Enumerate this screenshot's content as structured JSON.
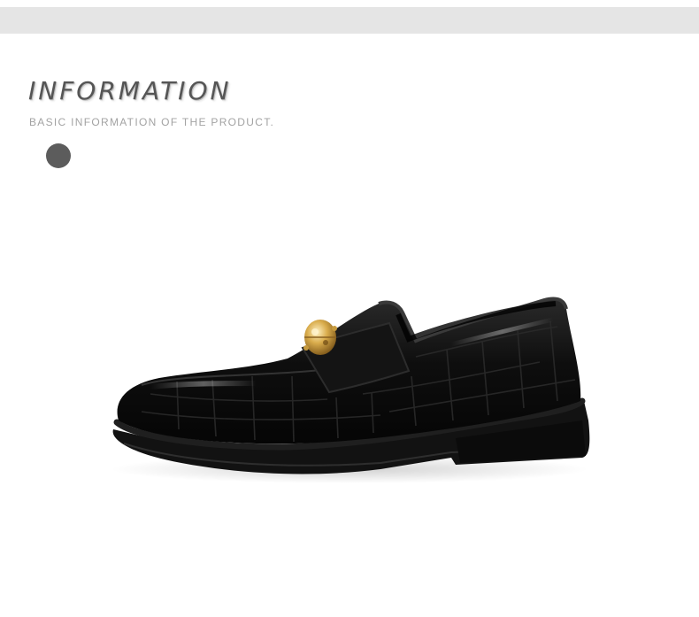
{
  "header": {
    "title": "INFORMATION",
    "subtitle": "BASIC INFORMATION OF THE PRODUCT."
  },
  "product_image": {
    "description_icon": "black-croc-embossed-loafer-with-gold-buckle",
    "colors": {
      "leather": "#0d0d0d",
      "sole": "#121212",
      "buckle": "#d4a94a",
      "accent_dot": "#5c5c5c",
      "top_band": "#e5e5e5"
    }
  }
}
